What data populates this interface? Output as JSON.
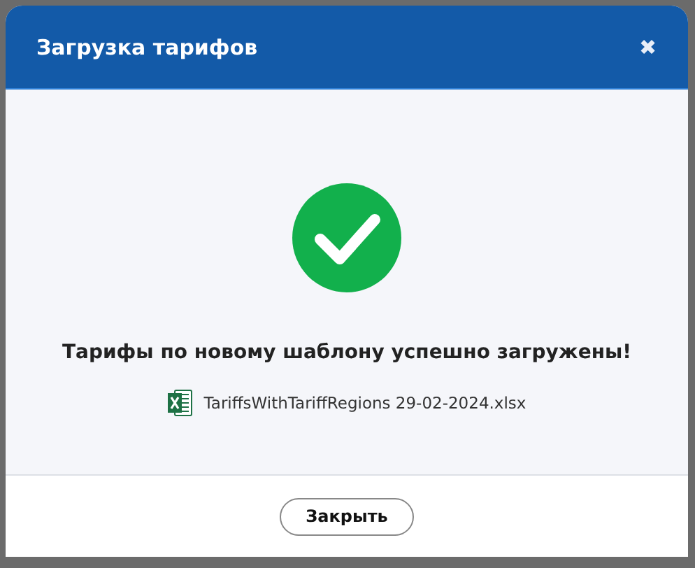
{
  "dialog": {
    "title": "Загрузка тарифов",
    "close": "✖"
  },
  "message": "Тарифы по новому шаблону успешно загружены!",
  "file": {
    "name": "TariffsWithTariffRegions 29-02-2024.xlsx"
  },
  "buttons": [
    "Закрыть"
  ]
}
